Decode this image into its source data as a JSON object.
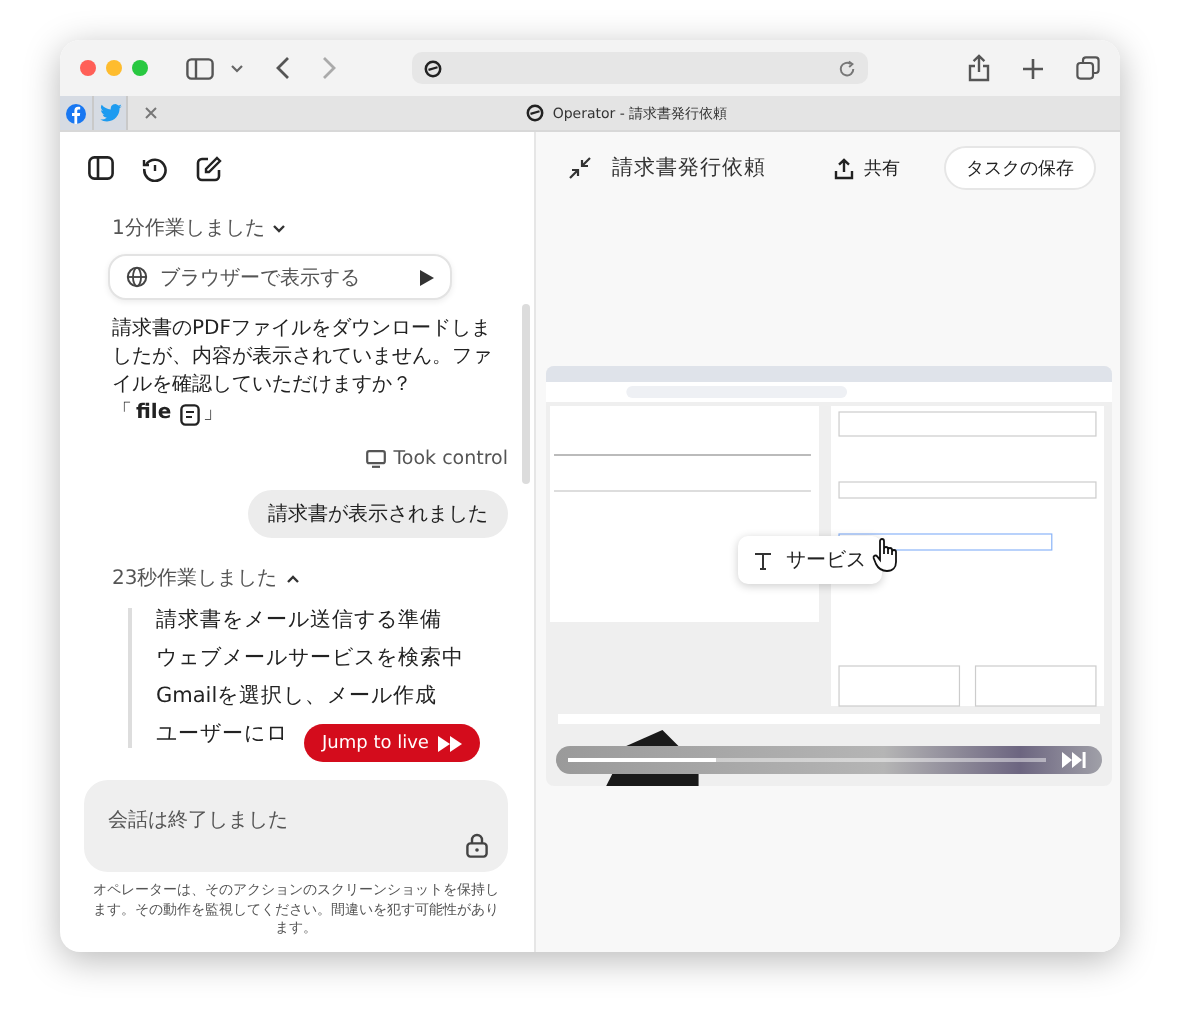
{
  "browser": {
    "tab_title": "Operator - 請求書発行依頼"
  },
  "chat": {
    "work1": {
      "label": "1分作業しました",
      "expanded": false
    },
    "browser_button": "ブラウザーで表示する",
    "message": "請求書のPDFファイルをダウンロードしましたが、内容が表示されていません。ファイルを確認していただけますか？",
    "attachment": {
      "open": "「",
      "name": "file",
      "close": "」"
    },
    "took_control": "Took control",
    "user_message": "請求書が表示されました",
    "work2": {
      "label": "23秒作業しました",
      "expanded": true,
      "steps": [
        "請求書をメール送信する準備",
        "ウェブメールサービスを検索中",
        "Gmailを選択し、メール作成",
        "ユーザーにロ"
      ]
    },
    "jump_button": "Jump to live",
    "composer": {
      "placeholder": "会話は終了しました"
    },
    "disclaimer": "オペレーターは、そのアクションのスクリーンショットを保持します。その動作を監視してください。間違いを犯す可能性があります。"
  },
  "task": {
    "title": "請求書発行依頼",
    "share": "共有",
    "save": "タスクの保存",
    "tooltip": "サービス",
    "playback": {
      "level": 0.3
    }
  }
}
